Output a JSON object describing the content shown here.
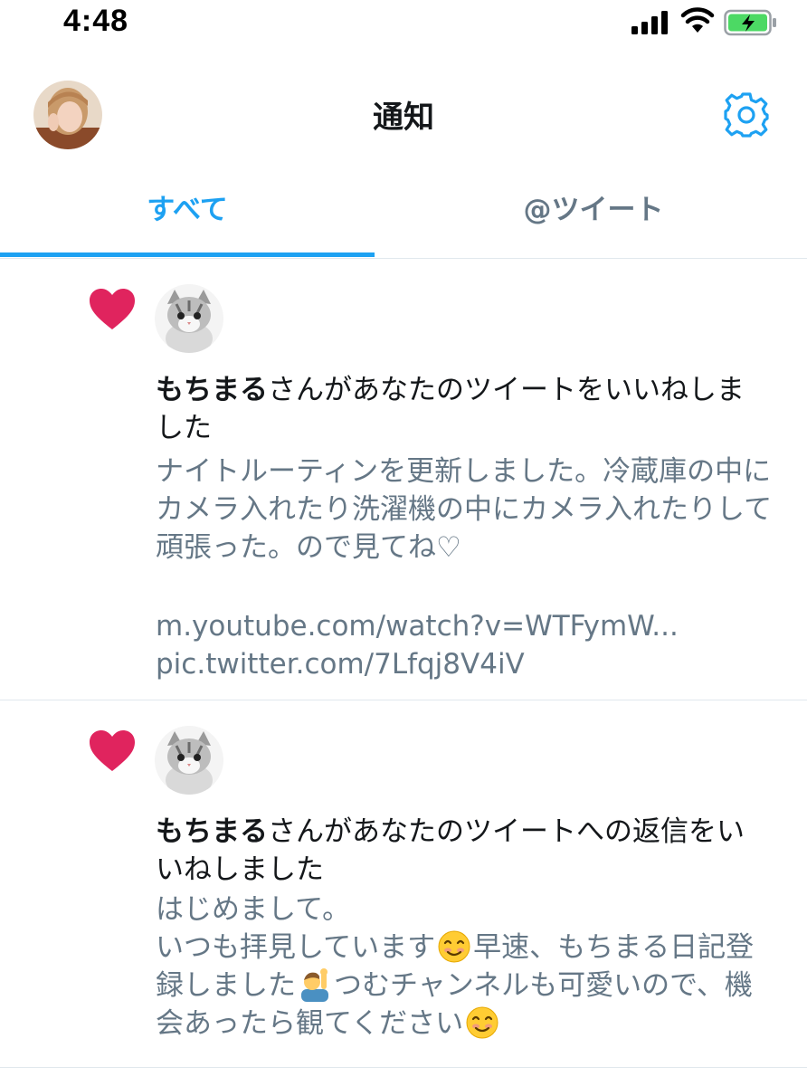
{
  "status_bar": {
    "time": "4:48"
  },
  "header": {
    "title": "通知"
  },
  "tabs": [
    {
      "label": "すべて",
      "active": true
    },
    {
      "label": "@ツイート",
      "active": false
    }
  ],
  "colors": {
    "accent": "#1da1f2",
    "heart": "#e0245e",
    "secondary_text": "#657786",
    "battery": "#4cd964"
  },
  "notifications": [
    {
      "icon": "heart-icon",
      "user_name": "もちまる",
      "action_text": "さんがあなたのツイートをいいねしました",
      "tweet_text": "ナイトルーティンを更新しました。冷蔵庫の中にカメラ入れたり洗濯機の中にカメラ入れたりして頑張った。ので見てね♡",
      "link_1": "m.youtube.com/watch?v=WTFymW...",
      "link_2": "pic.twitter.com/7Lfqj8V4iV"
    },
    {
      "icon": "heart-icon",
      "user_name": "もちまる",
      "action_text": "さんがあなたのツイートへの返信をいいねしました",
      "tweet_line_1": "はじめまして。",
      "tweet_line_2a": "いつも拝見しています",
      "tweet_line_2b": "早速、もちまる日記登録しました",
      "tweet_line_2c": "つむチャンネルも可愛いので、機会あったら観てください"
    }
  ]
}
